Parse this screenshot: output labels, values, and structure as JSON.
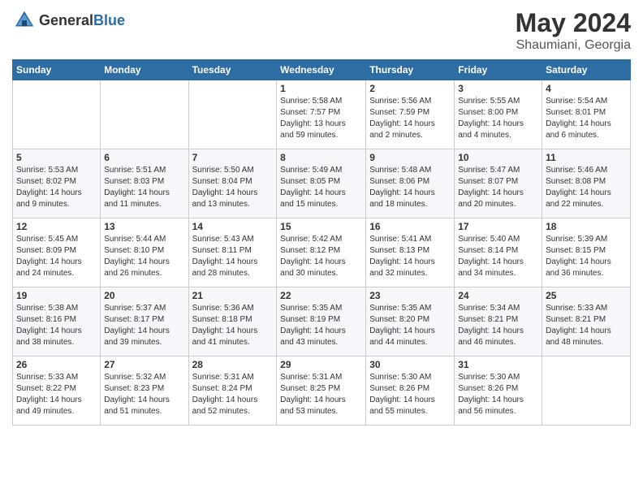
{
  "header": {
    "logo_general": "General",
    "logo_blue": "Blue",
    "month": "May 2024",
    "location": "Shaumiani, Georgia"
  },
  "weekdays": [
    "Sunday",
    "Monday",
    "Tuesday",
    "Wednesday",
    "Thursday",
    "Friday",
    "Saturday"
  ],
  "weeks": [
    [
      {
        "day": "",
        "info": ""
      },
      {
        "day": "",
        "info": ""
      },
      {
        "day": "",
        "info": ""
      },
      {
        "day": "1",
        "info": "Sunrise: 5:58 AM\nSunset: 7:57 PM\nDaylight: 13 hours\nand 59 minutes."
      },
      {
        "day": "2",
        "info": "Sunrise: 5:56 AM\nSunset: 7:59 PM\nDaylight: 14 hours\nand 2 minutes."
      },
      {
        "day": "3",
        "info": "Sunrise: 5:55 AM\nSunset: 8:00 PM\nDaylight: 14 hours\nand 4 minutes."
      },
      {
        "day": "4",
        "info": "Sunrise: 5:54 AM\nSunset: 8:01 PM\nDaylight: 14 hours\nand 6 minutes."
      }
    ],
    [
      {
        "day": "5",
        "info": "Sunrise: 5:53 AM\nSunset: 8:02 PM\nDaylight: 14 hours\nand 9 minutes."
      },
      {
        "day": "6",
        "info": "Sunrise: 5:51 AM\nSunset: 8:03 PM\nDaylight: 14 hours\nand 11 minutes."
      },
      {
        "day": "7",
        "info": "Sunrise: 5:50 AM\nSunset: 8:04 PM\nDaylight: 14 hours\nand 13 minutes."
      },
      {
        "day": "8",
        "info": "Sunrise: 5:49 AM\nSunset: 8:05 PM\nDaylight: 14 hours\nand 15 minutes."
      },
      {
        "day": "9",
        "info": "Sunrise: 5:48 AM\nSunset: 8:06 PM\nDaylight: 14 hours\nand 18 minutes."
      },
      {
        "day": "10",
        "info": "Sunrise: 5:47 AM\nSunset: 8:07 PM\nDaylight: 14 hours\nand 20 minutes."
      },
      {
        "day": "11",
        "info": "Sunrise: 5:46 AM\nSunset: 8:08 PM\nDaylight: 14 hours\nand 22 minutes."
      }
    ],
    [
      {
        "day": "12",
        "info": "Sunrise: 5:45 AM\nSunset: 8:09 PM\nDaylight: 14 hours\nand 24 minutes."
      },
      {
        "day": "13",
        "info": "Sunrise: 5:44 AM\nSunset: 8:10 PM\nDaylight: 14 hours\nand 26 minutes."
      },
      {
        "day": "14",
        "info": "Sunrise: 5:43 AM\nSunset: 8:11 PM\nDaylight: 14 hours\nand 28 minutes."
      },
      {
        "day": "15",
        "info": "Sunrise: 5:42 AM\nSunset: 8:12 PM\nDaylight: 14 hours\nand 30 minutes."
      },
      {
        "day": "16",
        "info": "Sunrise: 5:41 AM\nSunset: 8:13 PM\nDaylight: 14 hours\nand 32 minutes."
      },
      {
        "day": "17",
        "info": "Sunrise: 5:40 AM\nSunset: 8:14 PM\nDaylight: 14 hours\nand 34 minutes."
      },
      {
        "day": "18",
        "info": "Sunrise: 5:39 AM\nSunset: 8:15 PM\nDaylight: 14 hours\nand 36 minutes."
      }
    ],
    [
      {
        "day": "19",
        "info": "Sunrise: 5:38 AM\nSunset: 8:16 PM\nDaylight: 14 hours\nand 38 minutes."
      },
      {
        "day": "20",
        "info": "Sunrise: 5:37 AM\nSunset: 8:17 PM\nDaylight: 14 hours\nand 39 minutes."
      },
      {
        "day": "21",
        "info": "Sunrise: 5:36 AM\nSunset: 8:18 PM\nDaylight: 14 hours\nand 41 minutes."
      },
      {
        "day": "22",
        "info": "Sunrise: 5:35 AM\nSunset: 8:19 PM\nDaylight: 14 hours\nand 43 minutes."
      },
      {
        "day": "23",
        "info": "Sunrise: 5:35 AM\nSunset: 8:20 PM\nDaylight: 14 hours\nand 44 minutes."
      },
      {
        "day": "24",
        "info": "Sunrise: 5:34 AM\nSunset: 8:21 PM\nDaylight: 14 hours\nand 46 minutes."
      },
      {
        "day": "25",
        "info": "Sunrise: 5:33 AM\nSunset: 8:21 PM\nDaylight: 14 hours\nand 48 minutes."
      }
    ],
    [
      {
        "day": "26",
        "info": "Sunrise: 5:33 AM\nSunset: 8:22 PM\nDaylight: 14 hours\nand 49 minutes."
      },
      {
        "day": "27",
        "info": "Sunrise: 5:32 AM\nSunset: 8:23 PM\nDaylight: 14 hours\nand 51 minutes."
      },
      {
        "day": "28",
        "info": "Sunrise: 5:31 AM\nSunset: 8:24 PM\nDaylight: 14 hours\nand 52 minutes."
      },
      {
        "day": "29",
        "info": "Sunrise: 5:31 AM\nSunset: 8:25 PM\nDaylight: 14 hours\nand 53 minutes."
      },
      {
        "day": "30",
        "info": "Sunrise: 5:30 AM\nSunset: 8:26 PM\nDaylight: 14 hours\nand 55 minutes."
      },
      {
        "day": "31",
        "info": "Sunrise: 5:30 AM\nSunset: 8:26 PM\nDaylight: 14 hours\nand 56 minutes."
      },
      {
        "day": "",
        "info": ""
      }
    ]
  ]
}
